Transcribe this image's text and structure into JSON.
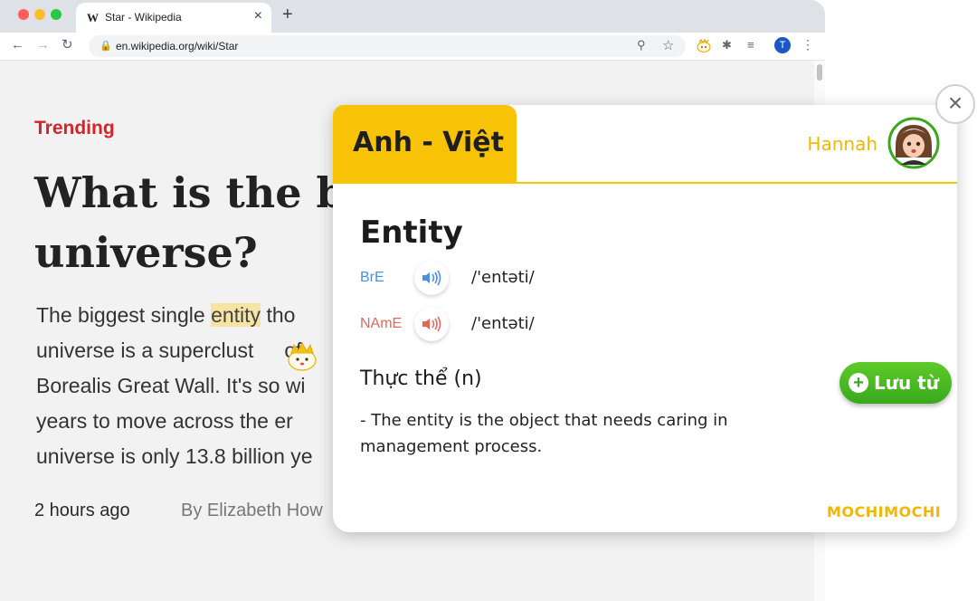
{
  "browser": {
    "tab_title": "Star - Wikipedia",
    "tab_favicon": "W",
    "tab_close": "×",
    "new_tab": "+",
    "url": "en.wikipedia.org/wiki/Star",
    "profile_initial": "T",
    "icons": [
      "back-arrow-icon",
      "forward-arrow-icon",
      "reload-icon",
      "lock-icon",
      "zoom-icon",
      "star-icon",
      "mochi-extension-icon",
      "puzzle-icon",
      "media-icon",
      "profile-avatar",
      "menu-dots-icon"
    ]
  },
  "article": {
    "category": "Trending",
    "headline": [
      "What is the bi",
      "universe?"
    ],
    "body": {
      "l1_before": "The biggest single ",
      "l1_highlight": "entity",
      "l1_after": " tho",
      "l2": "universe is a superclust",
      "l2_after": "of",
      "l3": "Borealis Great Wall. It's so wi",
      "l4": "years to move across the er",
      "l5": "universe is only 13.8 billion ye"
    },
    "time": "2 hours ago",
    "author": "By Elizabeth How"
  },
  "popup": {
    "language_pair": "Anh - Việt",
    "user_name": "Hannah",
    "close": "×",
    "word": "Entity",
    "pronunciations": [
      {
        "accent": "BrE",
        "ipa": "/'entəti/",
        "color": "#4a90e2"
      },
      {
        "accent": "NAmE",
        "ipa": "/'entəti/",
        "color": "#e2685a"
      }
    ],
    "meaning": "Thực thể (n)",
    "save_label": "Lưu từ",
    "save_plus": "+",
    "definition": "- The entity is the object that needs caring in management process.",
    "brand": "MOCHIMOCHI"
  },
  "colors": {
    "accent_yellow": "#f8c307",
    "trending_red": "#d4242a",
    "save_green": "#3aa81d",
    "highlight": "#f7e4a4"
  }
}
